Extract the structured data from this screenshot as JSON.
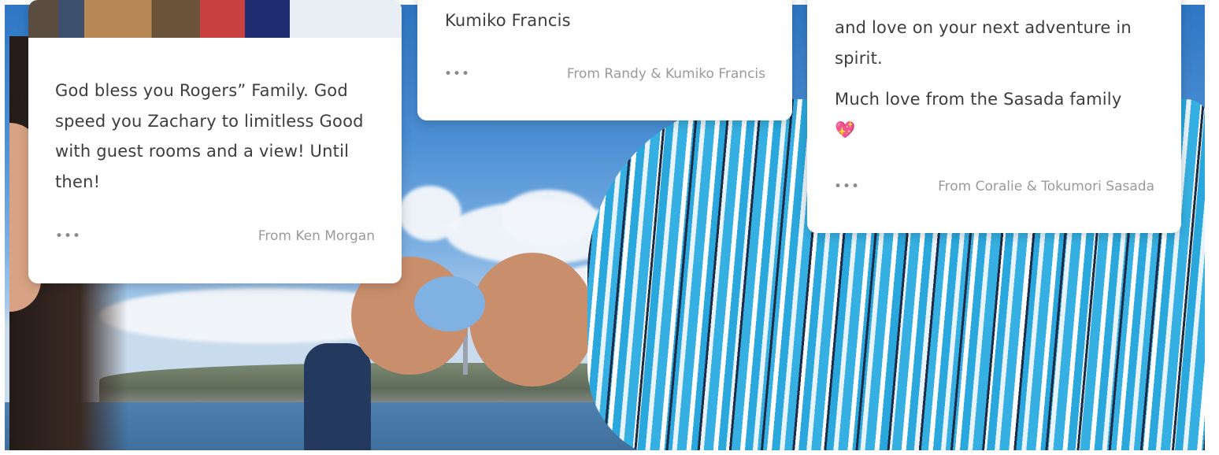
{
  "cards": [
    {
      "message": "God bless you Rogers” Family. God speed you Zachary to limitless Good with guest rooms and a view! Until then!",
      "more_label": "•••",
      "from": "From Ken Morgan"
    },
    {
      "message_tail": "Kumiko Francis",
      "more_label": "•••",
      "from": "From Randy & Kumiko Francis"
    },
    {
      "message_line1": "and love on your next adventure in",
      "message_line2": "spirit.",
      "message_line3": "Much love from the Sasada family",
      "emoji": "💖",
      "more_label": "•••",
      "from": "From Coralie & Tokumori Sasada"
    }
  ]
}
